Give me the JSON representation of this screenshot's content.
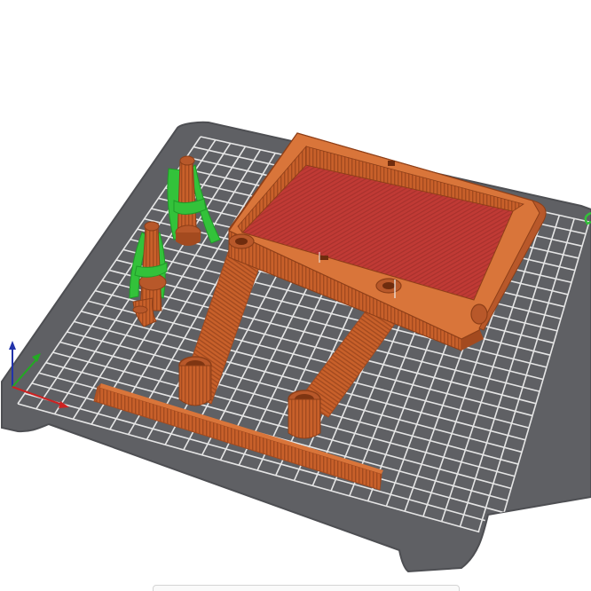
{
  "viewport": {
    "background": "#ffffff"
  },
  "bed": {
    "color": "#5f6064",
    "edge_color": "#4e4f53",
    "grid_color": "#e6e6e6"
  },
  "colors": {
    "wall": "#c8602a",
    "wall_dark": "#a34a1f",
    "wall_light": "#d9753a",
    "infill": "#c03a35",
    "infill_dark": "#a8312d",
    "support": "#33c23a",
    "support_dark": "#1f9a28",
    "axis_x": "#cc2222",
    "axis_y": "#22aa22",
    "axis_z": "#2233aa"
  },
  "icons": {
    "axis_gizmo": "axes-icon"
  }
}
